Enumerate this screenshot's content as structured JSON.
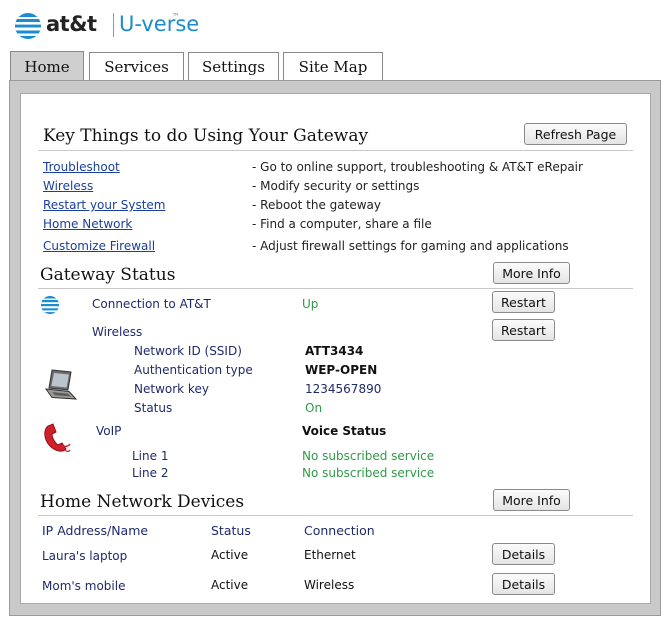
{
  "brand": {
    "att": "at&t",
    "uverse": "U-verse",
    "tm": "™"
  },
  "tabs": [
    "Home",
    "Services",
    "Settings",
    "Site Map"
  ],
  "key_things": {
    "title": "Key Things to do Using Your Gateway",
    "refresh_label": "Refresh Page",
    "items": [
      {
        "link": "Troubleshoot",
        "desc": "- Go to online support, troubleshooting & AT&T eRepair"
      },
      {
        "link": "Wireless",
        "desc": "- Modify security or settings"
      },
      {
        "link": "Restart your System",
        "desc": "- Reboot the gateway"
      },
      {
        "link": "Home Network",
        "desc": "- Find a computer, share a file"
      },
      {
        "link": "Customize Firewall",
        "desc": "- Adjust firewall settings for gaming and applications"
      }
    ]
  },
  "gateway_status": {
    "title": "Gateway Status",
    "more_info_label": "More Info",
    "connection_label": "Connection to AT&T",
    "connection_value": "Up",
    "restart_label": "Restart",
    "wireless_label": "Wireless",
    "wireless_rows": [
      {
        "label": "Network ID (SSID)",
        "value": "ATT3434"
      },
      {
        "label": "Authentication type",
        "value": "WEP-OPEN"
      },
      {
        "label": "Network key",
        "value": "1234567890"
      },
      {
        "label": "Status",
        "value": "On"
      }
    ],
    "voip_label": "VoIP",
    "voice_status_label": "Voice Status",
    "lines": [
      {
        "label": "Line 1",
        "value": "No subscribed service"
      },
      {
        "label": "Line 2",
        "value": "No subscribed service"
      }
    ]
  },
  "home_network": {
    "title": "Home Network Devices",
    "more_info_label": "More Info",
    "headers": [
      "IP Address/Name",
      "Status",
      "Connection"
    ],
    "details_label": "Details",
    "devices": [
      {
        "name": "Laura's laptop",
        "status": "Active",
        "connection": "Ethernet"
      },
      {
        "name": "Mom's mobile",
        "status": "Active",
        "connection": "Wireless"
      }
    ]
  },
  "colors": {
    "link": "#1a3f9c",
    "label": "#1f2a6b",
    "ok": "#2e9a48",
    "frame": "#c9c9c9",
    "uverse": "#1a8ccf"
  },
  "icons": [
    "att-globe-icon",
    "laptop-icon",
    "phone-icon"
  ]
}
